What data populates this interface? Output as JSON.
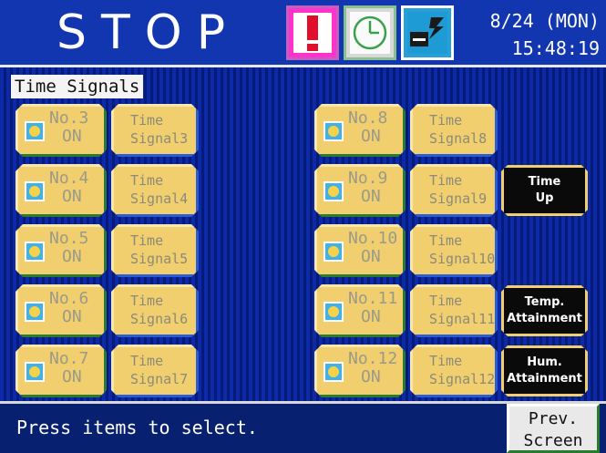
{
  "header": {
    "status": "STOP",
    "date": "8/24 (MON)",
    "time": "15:48:19",
    "icons": [
      "alarm-icon",
      "clock-icon",
      "communication-icon"
    ]
  },
  "section_label": "Time Signals",
  "signals": [
    {
      "no": "No.3",
      "state": "ON",
      "line1": "Time",
      "line2": "Signal3"
    },
    {
      "no": "No.4",
      "state": "ON",
      "line1": "Time",
      "line2": "Signal4"
    },
    {
      "no": "No.5",
      "state": "ON",
      "line1": "Time",
      "line2": "Signal5"
    },
    {
      "no": "No.6",
      "state": "ON",
      "line1": "Time",
      "line2": "Signal6"
    },
    {
      "no": "No.7",
      "state": "ON",
      "line1": "Time",
      "line2": "Signal7"
    },
    {
      "no": "No.8",
      "state": "ON",
      "line1": "Time",
      "line2": "Signal8"
    },
    {
      "no": "No.9",
      "state": "ON",
      "line1": "Time",
      "line2": "Signal9"
    },
    {
      "no": "No.10",
      "state": "ON",
      "line1": "Time",
      "line2": "Signal10"
    },
    {
      "no": "No.11",
      "state": "ON",
      "line1": "Time",
      "line2": "Signal11"
    },
    {
      "no": "No.12",
      "state": "ON",
      "line1": "Time",
      "line2": "Signal12"
    }
  ],
  "conditions": [
    {
      "line1": "Time",
      "line2": "Up"
    },
    {
      "line1": "Temp.",
      "line2": "Attainment"
    },
    {
      "line1": "Hum.",
      "line2": "Attainment"
    }
  ],
  "footer": {
    "prompt": "Press items to select.",
    "prev_line1": "Prev.",
    "prev_line2": "Screen"
  }
}
